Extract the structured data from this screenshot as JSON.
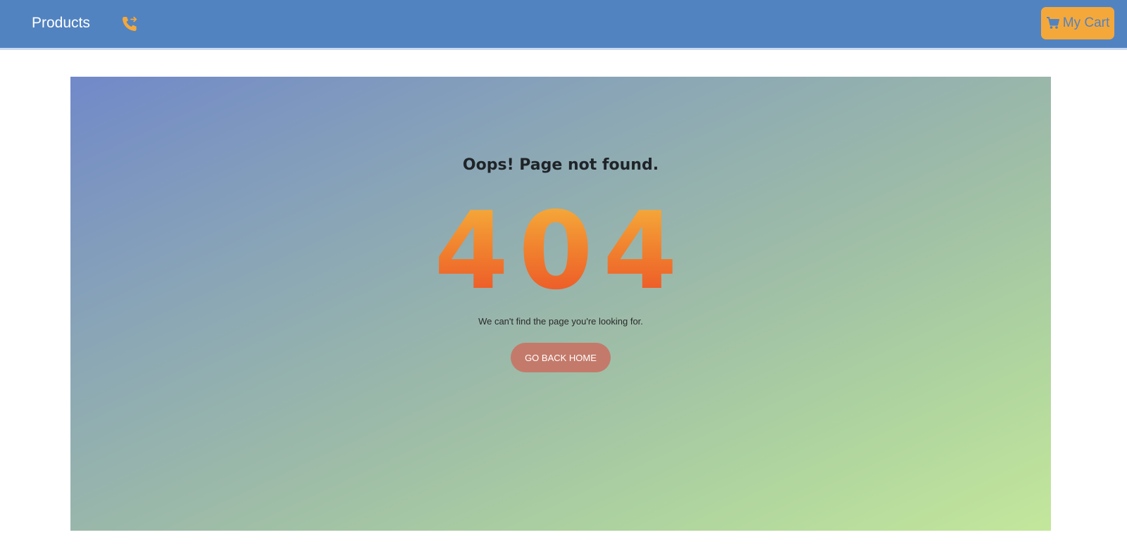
{
  "nav": {
    "brand": "Products",
    "phone_icon": "phone-forward-icon",
    "cart_icon": "shopping-cart-icon",
    "cart_label": "My Cart"
  },
  "error_page": {
    "heading": "Oops! Page not found.",
    "code": "404",
    "message": "We can't find the page you're looking for.",
    "button_label": "GO BACK HOME"
  },
  "colors": {
    "navbar": "#5283c1",
    "accent_orange": "#f5a83a",
    "button": "#c47a6a",
    "gradient_start": "#7189c9",
    "gradient_end": "#c3e79b"
  }
}
